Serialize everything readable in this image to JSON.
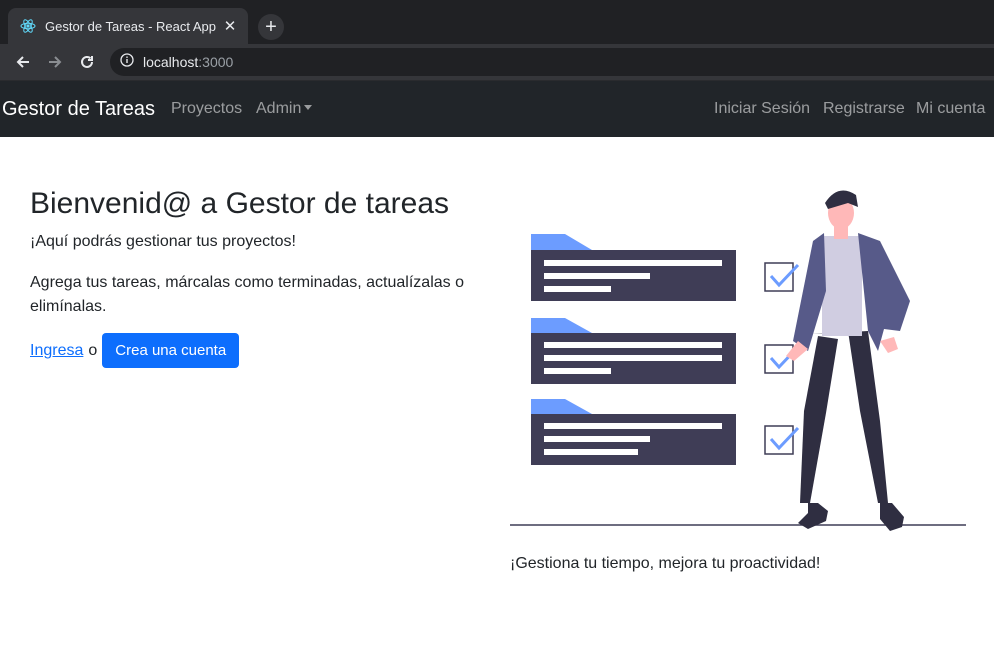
{
  "browser": {
    "tab_title": "Gestor de Tareas - React App",
    "tab_favicon": "react-icon",
    "url_host": "localhost",
    "url_port": ":3000"
  },
  "navbar": {
    "brand": "Gestor de Tareas",
    "left_links": [
      "Proyectos",
      "Admin"
    ],
    "right_links": [
      "Iniciar Sesión",
      "Registrarse",
      "Mi cuenta"
    ]
  },
  "hero": {
    "title": "Bienvenid@ a Gestor de tareas",
    "lead1": "¡Aquí podrás gestionar tus proyectos!",
    "lead2": "Agrega tus tareas, márcalas como terminadas, actualízalas o elimínalas.",
    "login_link": "Ingresa",
    "separator": "o",
    "signup_button": "Crea una cuenta"
  },
  "illustration": {
    "caption": "¡Gestiona tu tiempo, mejora tu proactividad!",
    "accent_color": "#6c9cff",
    "card_color": "#3f3d56"
  },
  "colors": {
    "navbar_bg": "#212529",
    "primary": "#0d6efd"
  }
}
